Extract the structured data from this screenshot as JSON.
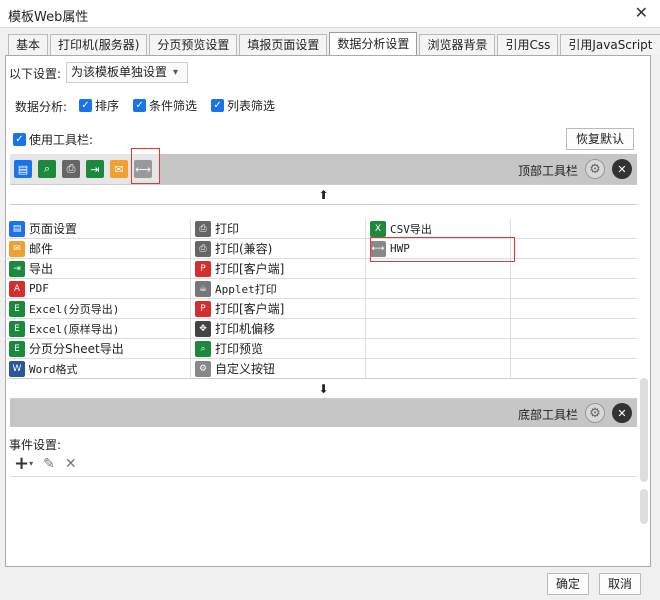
{
  "window": {
    "title": "模板Web属性",
    "close_glyph": "✕"
  },
  "tabs": [
    {
      "label": "基本"
    },
    {
      "label": "打印机(服务器)"
    },
    {
      "label": "分页预览设置"
    },
    {
      "label": "填报页面设置"
    },
    {
      "label": "数据分析设置",
      "active": true
    },
    {
      "label": "浏览器背景"
    },
    {
      "label": "引用Css"
    },
    {
      "label": "引用JavaScript"
    }
  ],
  "settings": {
    "label": "以下设置:",
    "select_value": "为该模板单独设置",
    "analysis_label": "数据分析:",
    "options": [
      {
        "label": "排序",
        "checked": true
      },
      {
        "label": "条件筛选",
        "checked": true
      },
      {
        "label": "列表筛选",
        "checked": true
      }
    ],
    "use_toolbar_label": "使用工具栏:",
    "use_toolbar_checked": true,
    "restore_default": "恢复默认"
  },
  "top_toolbar": {
    "label": "顶部工具栏",
    "icons": [
      "page-setup-icon",
      "preview-icon",
      "print-icon",
      "export-icon",
      "email-icon",
      "hwp-icon"
    ]
  },
  "bottom_toolbar": {
    "label": "底部工具栏"
  },
  "up_arrow": "⬆",
  "down_arrow": "⬇",
  "grid": [
    [
      {
        "label": "页面设置",
        "icon": "page-setup-icon",
        "color": "#1a73e8"
      },
      {
        "label": "打印",
        "icon": "print-icon",
        "color": "#666666"
      },
      {
        "label": "CSV导出",
        "icon": "csv-icon",
        "color": "#1b8a3e",
        "mono": true
      },
      {
        "label": ""
      }
    ],
    [
      {
        "label": "邮件",
        "icon": "email-icon",
        "color": "#f0a030"
      },
      {
        "label": "打印(兼容)",
        "icon": "print-icon",
        "color": "#666666"
      },
      {
        "label": "HWP",
        "icon": "hwp-icon",
        "color": "#888888",
        "mono": true
      },
      {
        "label": ""
      }
    ],
    [
      {
        "label": "导出",
        "icon": "export-icon",
        "color": "#1b8a3e"
      },
      {
        "label": "打印[客户端]",
        "icon": "pdf-print-icon",
        "color": "#d32f2f"
      },
      {
        "label": ""
      },
      {
        "label": ""
      }
    ],
    [
      {
        "label": "PDF",
        "icon": "pdf-icon",
        "color": "#d32f2f",
        "mono": true
      },
      {
        "label": "Applet打印",
        "icon": "applet-icon",
        "color": "#777777",
        "mono": true
      },
      {
        "label": ""
      },
      {
        "label": ""
      }
    ],
    [
      {
        "label": "Excel(分页导出)",
        "icon": "excel-icon",
        "color": "#1b8a3e",
        "mono": true
      },
      {
        "label": "打印[客户端]",
        "icon": "pdf-print-icon",
        "color": "#d32f2f"
      },
      {
        "label": ""
      },
      {
        "label": ""
      }
    ],
    [
      {
        "label": "Excel(原样导出)",
        "icon": "excel-icon",
        "color": "#1b8a3e",
        "mono": true
      },
      {
        "label": "打印机偏移",
        "icon": "move-icon",
        "color": "#444444"
      },
      {
        "label": ""
      },
      {
        "label": ""
      }
    ],
    [
      {
        "label": "分页分Sheet导出",
        "icon": "excel-icon",
        "color": "#1b8a3e"
      },
      {
        "label": "打印预览",
        "icon": "preview-icon",
        "color": "#1b8a3e"
      },
      {
        "label": ""
      },
      {
        "label": ""
      }
    ],
    [
      {
        "label": "Word格式",
        "icon": "word-icon",
        "color": "#2b579a",
        "mono": true
      },
      {
        "label": "自定义按钮",
        "icon": "gear-icon",
        "color": "#888888"
      },
      {
        "label": ""
      },
      {
        "label": ""
      }
    ]
  ],
  "events": {
    "label": "事件设置:",
    "add": "+",
    "edit": "✎",
    "delete": "✕"
  },
  "footer": {
    "ok": "确定",
    "cancel": "取消"
  }
}
